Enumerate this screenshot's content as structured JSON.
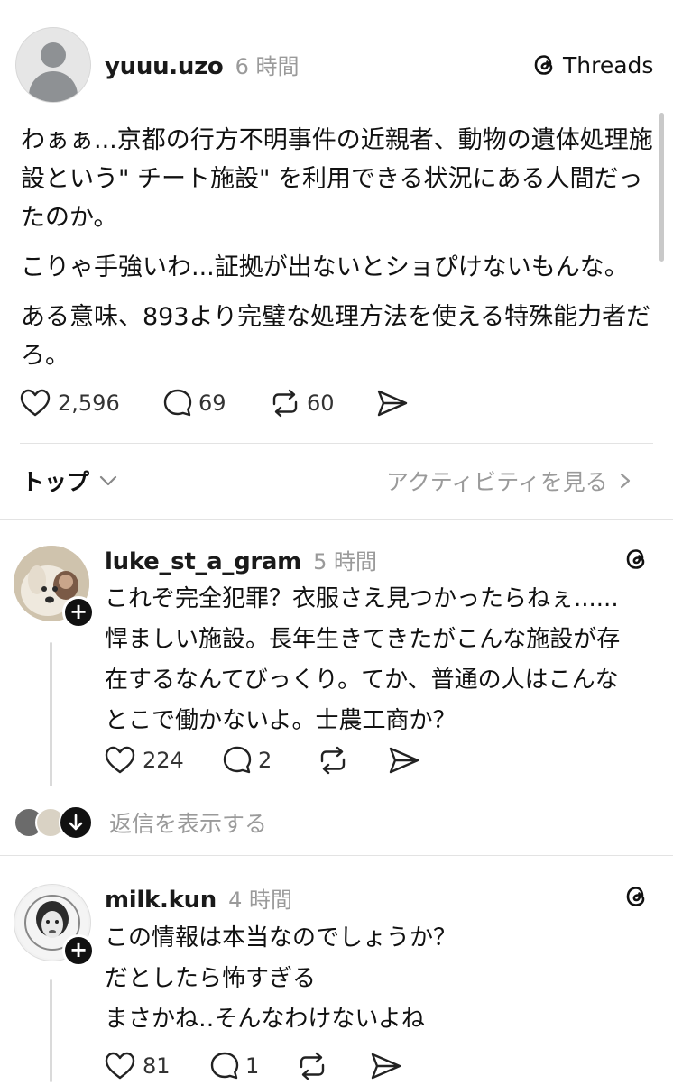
{
  "post": {
    "username": "yuuu.uzo",
    "time": "6 時間",
    "brand": "Threads",
    "paragraphs": [
      "わぁぁ...京都の行方不明事件の近親者、動物の遺体処理施",
      "設という\" チート施設\" を利用できる状況にある人間だっ",
      "たのか。",
      "こりゃ手強いわ...証拠が出ないとショぴけないもんな。",
      "ある意味、893より完璧な処理方法を使える特殊能力者だ",
      "ろ。"
    ],
    "likes": "2,596",
    "comments": "69",
    "reposts": "60"
  },
  "sort": {
    "label": "トップ",
    "activity": "アクティビティを見る"
  },
  "replies": [
    {
      "username": "luke_st_a_gram",
      "time": "5 時間",
      "lines": [
        "これぞ完全犯罪？衣服さえ見つかったらねぇ......",
        "悍ましい施設。長年生きてきたがこんな施設が存",
        "在するなんてびっくり。てか、普通の人はこんな",
        "とこで働かないよ。士農工商か？"
      ],
      "likes": "224",
      "comments": "2",
      "show_replies": "返信を表示する"
    },
    {
      "username": "milk.kun",
      "time": "4 時間",
      "lines": [
        "この情報は本当なのでしょうか？",
        "だとしたら怖すぎる",
        "まさかね‥そんなわけないよね"
      ],
      "likes": "81",
      "comments": "1"
    }
  ]
}
